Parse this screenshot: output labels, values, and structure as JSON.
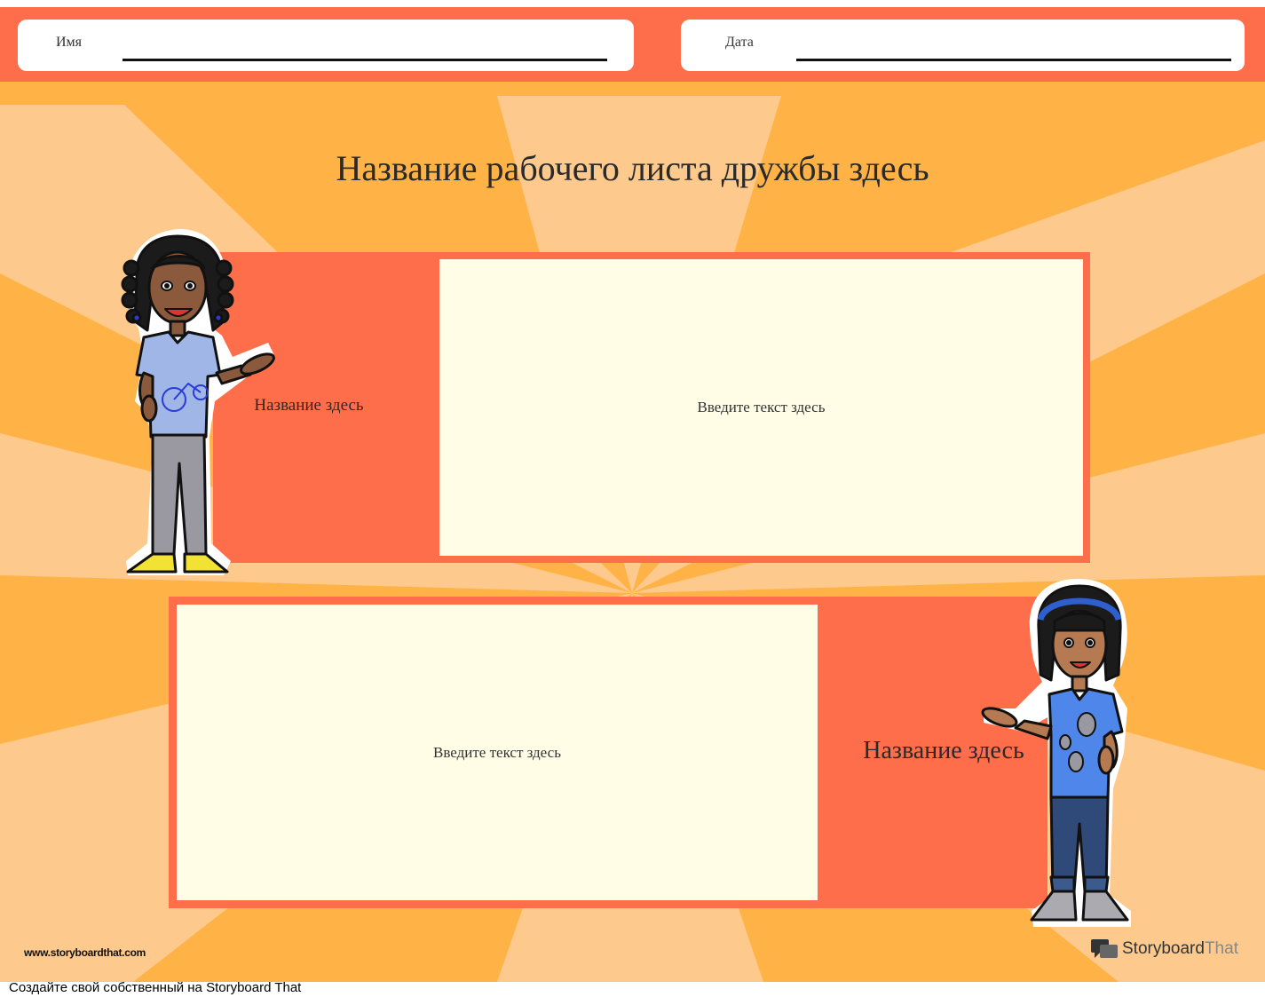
{
  "header": {
    "name_label": "Имя",
    "date_label": "Дата"
  },
  "worksheet": {
    "title": "Название рабочего листа дружбы здесь",
    "row1": {
      "label": "Название здесь",
      "text": "Введите текст здесь"
    },
    "row2": {
      "label": "Название здесь",
      "text": "Введите текст здесь"
    }
  },
  "branding": {
    "site_url": "www.storyboardthat.com",
    "logo_word1": "Storyboard",
    "logo_word2": "That"
  },
  "footer": {
    "cta": "Создайте свой собственный на Storyboard That"
  },
  "colors": {
    "background": "#ffb347",
    "ray": "#fdc98c",
    "header": "#ff6e4a",
    "panel": "#ff6e4a",
    "text_box": "#fffde6"
  },
  "icons": [
    "storyboardthat-logo-icon",
    "girl-with-braids-character",
    "girl-with-headband-character"
  ]
}
